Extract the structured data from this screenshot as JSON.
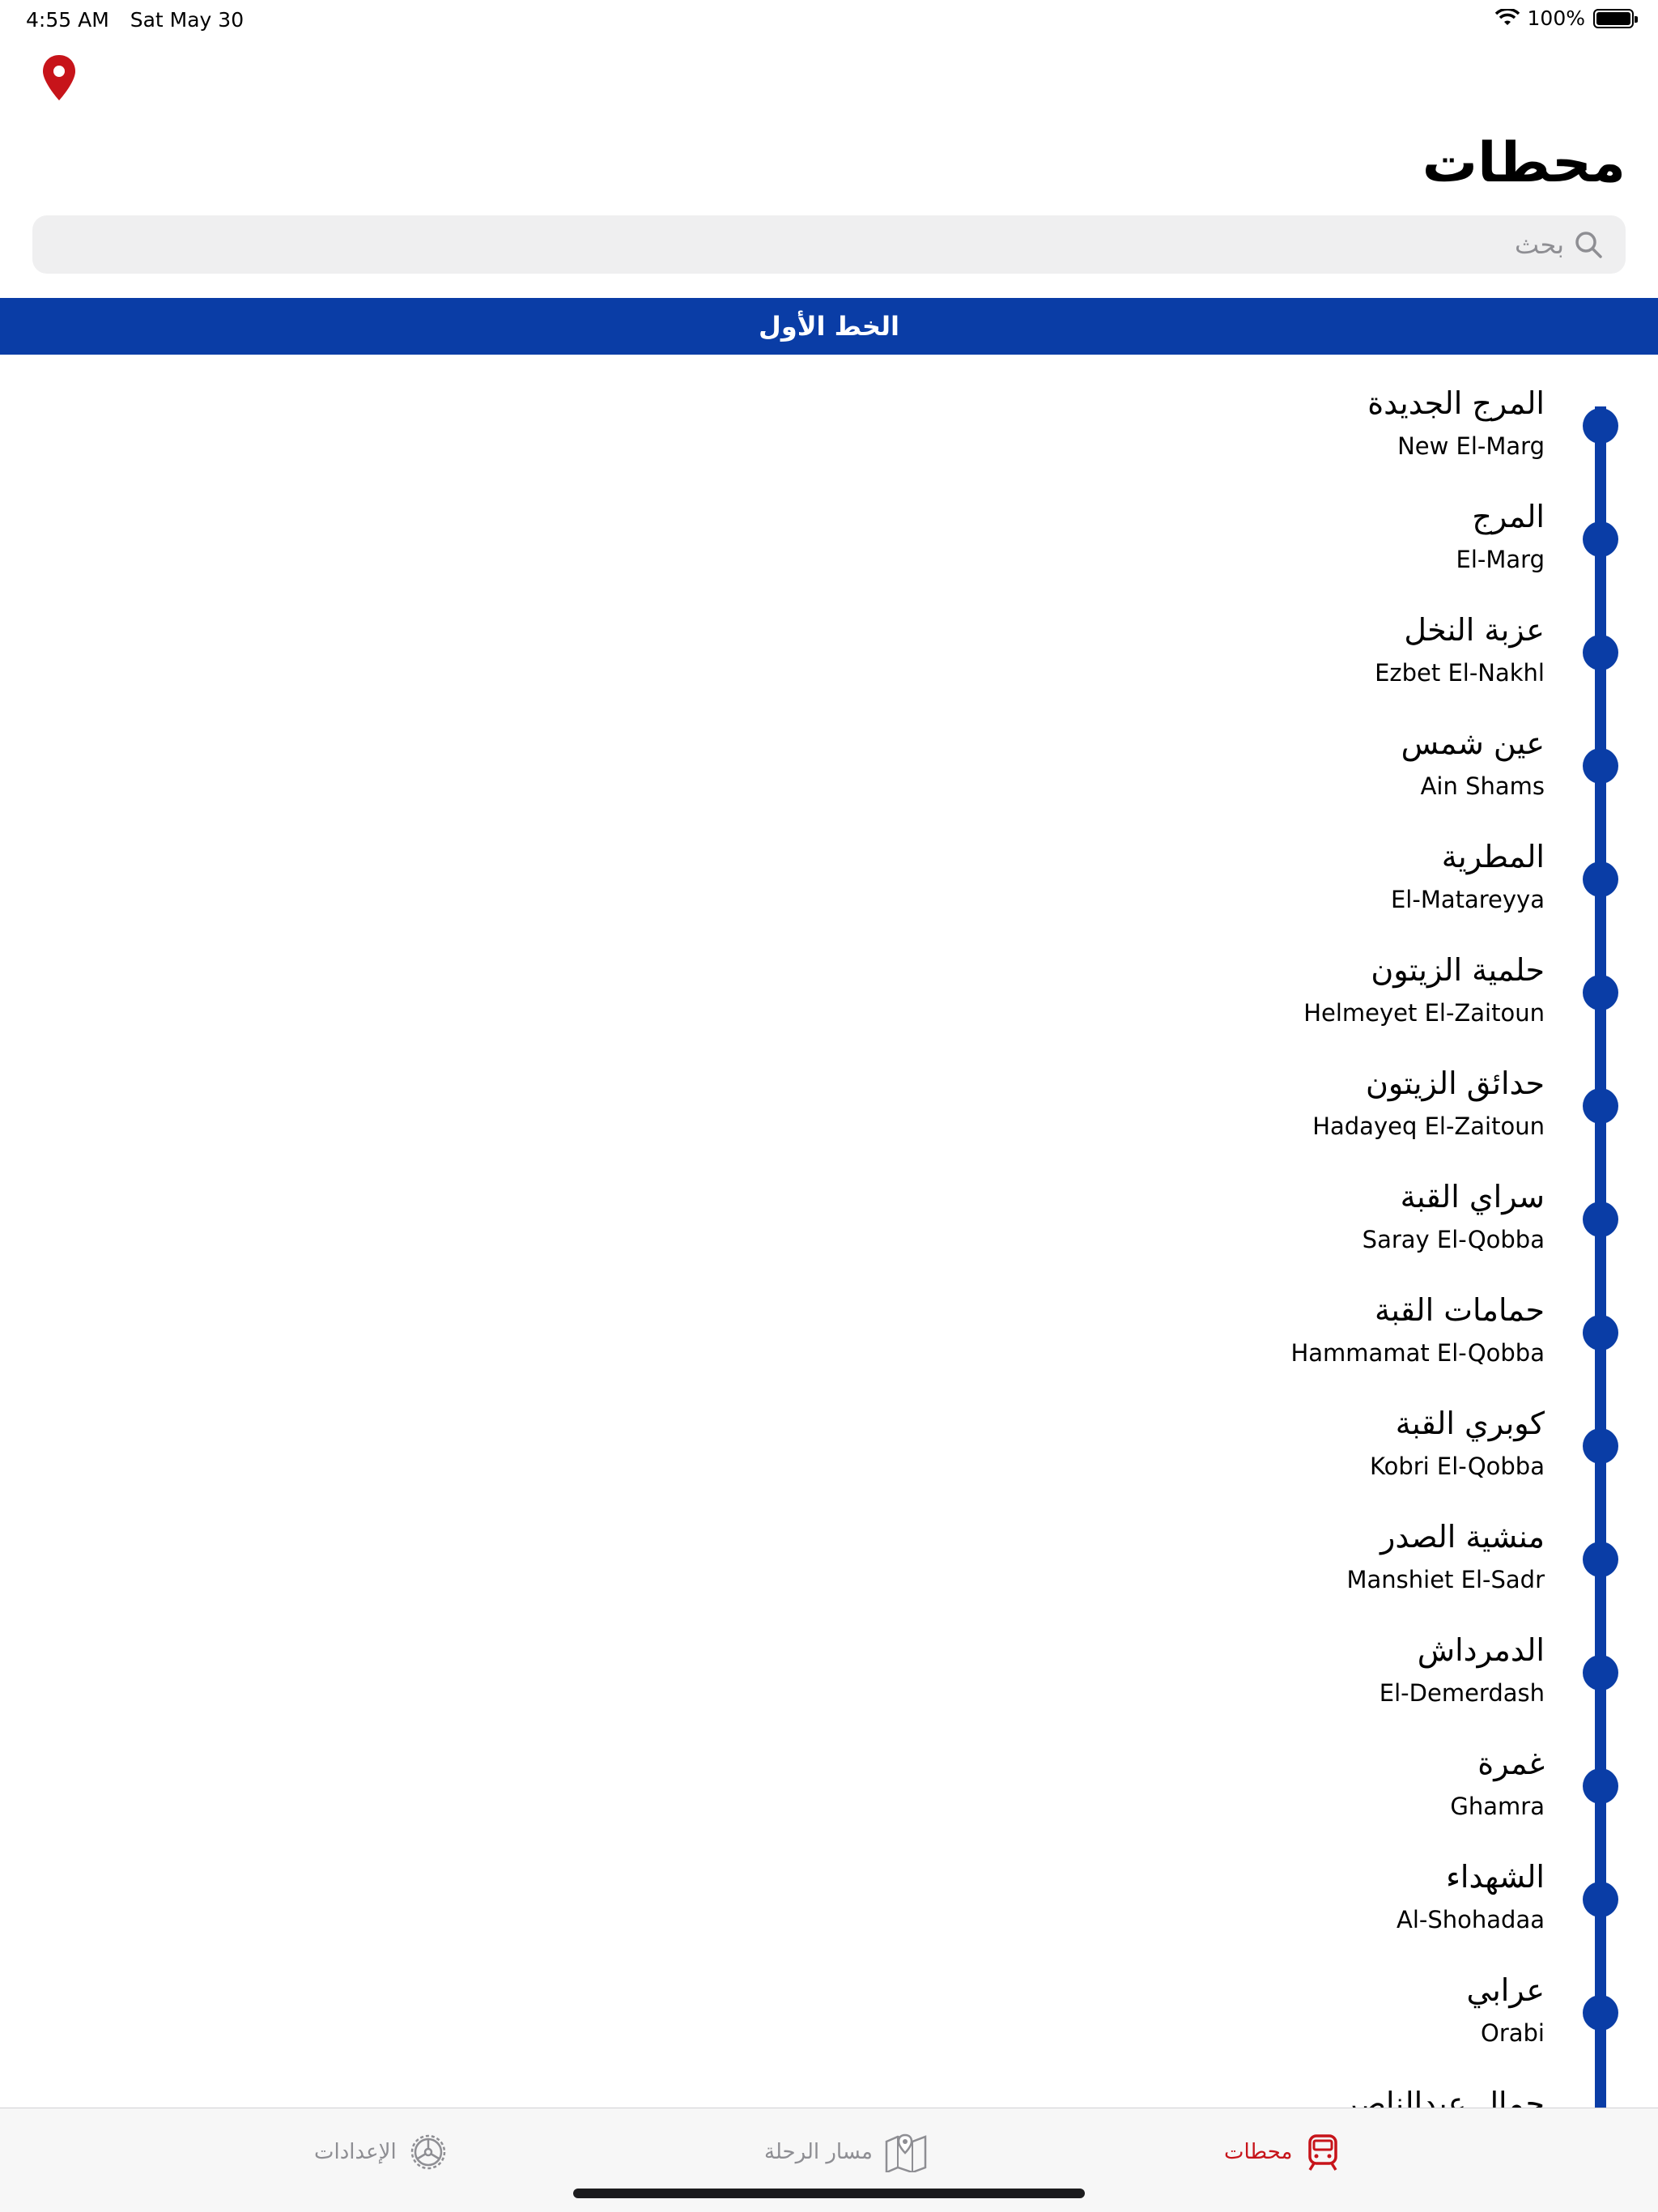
{
  "status_bar": {
    "time": "4:55 AM",
    "date": "Sat May 30",
    "battery": "100%"
  },
  "header": {
    "title": "محطات",
    "location_icon": "location-pin-icon"
  },
  "search": {
    "placeholder": "بحث",
    "value": ""
  },
  "line": {
    "title": "الخط الأول",
    "color": "#0a3da6"
  },
  "stations": [
    {
      "ar": "المرج الجديدة",
      "en": "New El-Marg"
    },
    {
      "ar": "المرج",
      "en": "El-Marg"
    },
    {
      "ar": "عزبة النخل",
      "en": "Ezbet El-Nakhl"
    },
    {
      "ar": "عين شمس",
      "en": "Ain Shams"
    },
    {
      "ar": "المطرية",
      "en": "El-Matareyya"
    },
    {
      "ar": "حلمية الزيتون",
      "en": "Helmeyet El-Zaitoun"
    },
    {
      "ar": "حدائق الزيتون",
      "en": "Hadayeq El-Zaitoun"
    },
    {
      "ar": "سراي القبة",
      "en": "Saray El-Qobba"
    },
    {
      "ar": "حمامات القبة",
      "en": "Hammamat El-Qobba"
    },
    {
      "ar": "كوبري القبة",
      "en": "Kobri El-Qobba"
    },
    {
      "ar": "منشية الصدر",
      "en": "Manshiet El-Sadr"
    },
    {
      "ar": "الدمرداش",
      "en": "El-Demerdash"
    },
    {
      "ar": "غمرة",
      "en": "Ghamra"
    },
    {
      "ar": "الشهداء",
      "en": "Al-Shohadaa"
    },
    {
      "ar": "عرابي",
      "en": "Orabi"
    },
    {
      "ar": "جمال عبدالناصر",
      "en": ""
    }
  ],
  "tabs": [
    {
      "label": "محطات",
      "icon": "train-icon",
      "active": true
    },
    {
      "label": "مسار الرحلة",
      "icon": "map-route-icon",
      "active": false
    },
    {
      "label": "الإعدادات",
      "icon": "settings-wheel-icon",
      "active": false
    }
  ],
  "colors": {
    "accent": "#c7141a",
    "line_blue": "#0a3da6",
    "inactive": "#8e8e93"
  }
}
